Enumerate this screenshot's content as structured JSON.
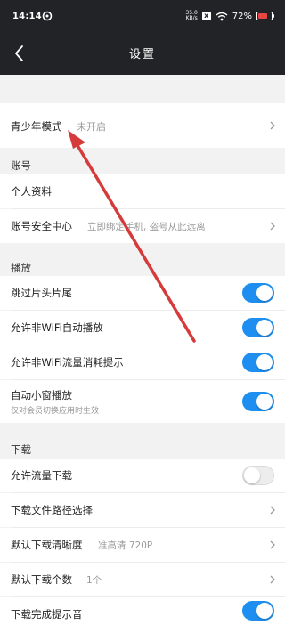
{
  "status_bar": {
    "time": "14:14",
    "network_speed": "35.0 KB/s",
    "x_badge": "x",
    "battery": "72%",
    "battery_level": 0.72
  },
  "nav": {
    "title": "设置"
  },
  "youth_mode": {
    "label": "青少年模式",
    "value": "未开启"
  },
  "account": {
    "header": "账号",
    "profile": "个人资料",
    "security_center": "账号安全中心",
    "security_hint": "立即绑定手机, 盗号从此远离"
  },
  "playback": {
    "header": "播放",
    "skip_intro": "跳过片头片尾",
    "wifi_autoplay": "允许非WiFi自动播放",
    "wifi_data_alert": "允许非WiFi流量消耗提示",
    "mini_window": "自动小窗播放",
    "mini_window_hint": "仅对会员切换应用时生效"
  },
  "download": {
    "header": "下载",
    "allow_data": "允许流量下载",
    "path": "下载文件路径选择",
    "quality": "默认下载清晰度",
    "quality_value": "准高清 720P",
    "count": "默认下载个数",
    "count_value": "1个",
    "complete_alert": "下载完成提示音"
  },
  "toggles": {
    "skip_intro": true,
    "wifi_autoplay": true,
    "wifi_data_alert": true,
    "mini_window": true,
    "allow_data": false,
    "complete_alert": true
  },
  "colors": {
    "header_bg": "#222327",
    "toggle_on": "#1e8ff0",
    "annotation_arrow": "#d63b3b"
  }
}
